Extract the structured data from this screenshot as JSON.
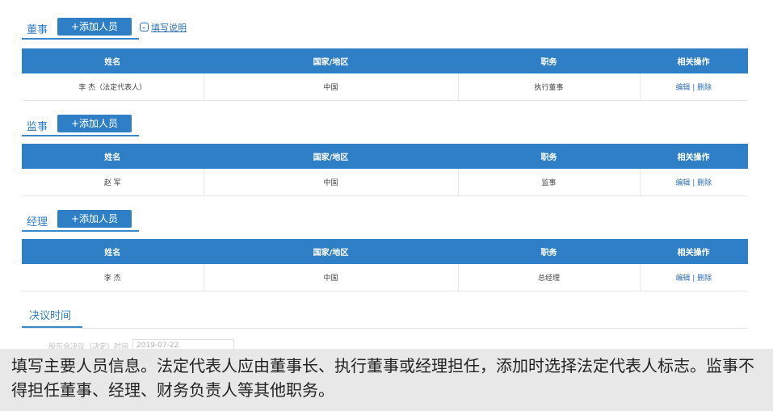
{
  "table_headers": [
    "姓名",
    "国家/地区",
    "职务",
    "相关操作"
  ],
  "op_edit": "编辑",
  "op_sep": "|",
  "op_delete": "删除",
  "add_label": "+添加人员",
  "directors": {
    "title": "董事",
    "help_link": "填写说明",
    "rows": [
      {
        "name": "李  杰（法定代表人）",
        "country": "中国",
        "position": "执行董事"
      }
    ]
  },
  "supervisors": {
    "title": "监事",
    "rows": [
      {
        "name": "赵  军",
        "country": "中国",
        "position": "监事"
      }
    ]
  },
  "managers": {
    "title": "经理",
    "rows": [
      {
        "name": "李  杰",
        "country": "中国",
        "position": "总经理"
      }
    ]
  },
  "decision": {
    "title": "决议时间",
    "label": "股东会决议（决定）时间",
    "value": "2019-07-22"
  },
  "caption": "填写主要人员信息。法定代表人应由董事长、执行董事或经理担任，添加时选择法定代表人标志。监事不得担任董事、经理、财务负责人等其他职务。"
}
